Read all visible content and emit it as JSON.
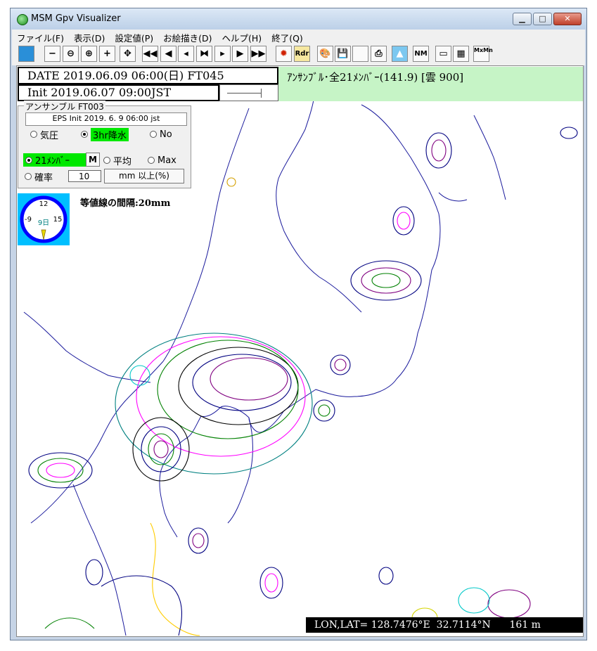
{
  "window": {
    "title": "MSM Gpv Visualizer",
    "controls": {
      "minimize": "▁",
      "maximize": "□",
      "close": "✕"
    }
  },
  "menu": [
    "ファイル(F)",
    "表示(D)",
    "設定値(P)",
    "お絵描き(D)",
    "ヘルプ(H)",
    "終了(Q)"
  ],
  "toolbar": {
    "buttons": [
      {
        "name": "map-view-button",
        "label": ""
      },
      {
        "name": "zoom-minus-button",
        "label": "−"
      },
      {
        "name": "zoom-out-button",
        "label": "⊖"
      },
      {
        "name": "zoom-in-button",
        "label": "⊕"
      },
      {
        "name": "zoom-plus-button",
        "label": "+"
      },
      {
        "name": "center-button",
        "label": "✥"
      },
      {
        "name": "first-button",
        "label": "◀◀"
      },
      {
        "name": "prev-fast-button",
        "label": "◀"
      },
      {
        "name": "prev-button",
        "label": "◂"
      },
      {
        "name": "stop-button",
        "label": "⧓"
      },
      {
        "name": "next-button",
        "label": "▸"
      },
      {
        "name": "next-fast-button",
        "label": "▶"
      },
      {
        "name": "last-button",
        "label": "▶▶"
      },
      {
        "name": "settings-button",
        "label": "✹"
      },
      {
        "name": "radar-button",
        "label": "Rdr"
      },
      {
        "name": "palette-button",
        "label": "🎨"
      },
      {
        "name": "save-button",
        "label": "💾"
      },
      {
        "name": "blank-button",
        "label": ""
      },
      {
        "name": "printer-button",
        "label": "⎙"
      },
      {
        "name": "mountain-button",
        "label": "▲"
      },
      {
        "name": "nm-button",
        "label": "NM"
      },
      {
        "name": "window-button",
        "label": "▭"
      },
      {
        "name": "grid-button",
        "label": "▦"
      },
      {
        "name": "minmax-button",
        "label": "MxMn"
      }
    ]
  },
  "header": {
    "date_line": "DATE 2019.06.09 06:00(日) FT045",
    "init_line": "Init 2019.06.07 09:00JST",
    "ensemble_line": "ｱﾝｻﾝﾌﾞﾙ･全21ﾒﾝﾊﾞｰ(141.9) [雲 900]"
  },
  "panel": {
    "title": "アンサンブル FT003",
    "eps_init": "EPS Init    2019. 6. 9   06:00 jst",
    "radio_pressure": "気圧",
    "radio_3hr": "3hr降水",
    "radio_no": "No",
    "radio_21members": "21ﾒﾝﾊﾞｰ",
    "m_button": "M",
    "radio_average": "平均",
    "radio_max": "Max",
    "radio_probability": "確率",
    "prob_value": "10",
    "mm_button": "mm 以上(%)"
  },
  "clock": {
    "n12": "12",
    "n15": "15",
    "n9": "-9",
    "day": "9日"
  },
  "contour_interval": "等値線の間隔:20mm",
  "status": {
    "coords": "LON,LAT= 128.7476°E  32.7114°N      161 m"
  },
  "colors": {
    "ensemble_bg": "#c6f4c6",
    "selection_green": "#00e800",
    "clock_bg": "#00bfff",
    "coast": "#1a1a9c"
  }
}
